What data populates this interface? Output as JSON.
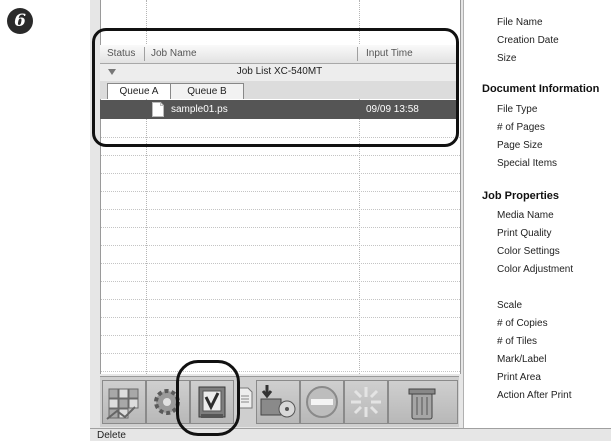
{
  "step_marker": "6",
  "job_list": {
    "columns": [
      "Status",
      "Job Name",
      "Input Time"
    ],
    "group_title": "Job List XC-540MT",
    "tabs": [
      "Queue A",
      "Queue B"
    ],
    "selected_job": {
      "name": "sample01.ps",
      "input_time": "09/09 13:58"
    }
  },
  "toolbar": {
    "buttons": [
      "layout-icon",
      "gear-icon",
      "rip-print-icon",
      "document-icon",
      "print-to-device-icon",
      "stop-icon",
      "starburst-icon",
      "trash-icon"
    ]
  },
  "status_bar": {
    "text": "Delete"
  },
  "properties_panel": {
    "top_items": [
      "File Name",
      "Creation Date",
      "Size"
    ],
    "document_info": {
      "heading": "Document Information",
      "items": [
        "File Type",
        "# of Pages",
        "Page Size",
        "Special Items"
      ]
    },
    "job_properties": {
      "heading": "Job Properties",
      "items": [
        "Media Name",
        "Print Quality",
        "Color Settings",
        "Color Adjustment"
      ]
    },
    "extra_items": [
      "Scale",
      "# of Copies",
      "# of Tiles",
      "Mark/Label",
      "Print Area",
      "Action After Print"
    ]
  }
}
